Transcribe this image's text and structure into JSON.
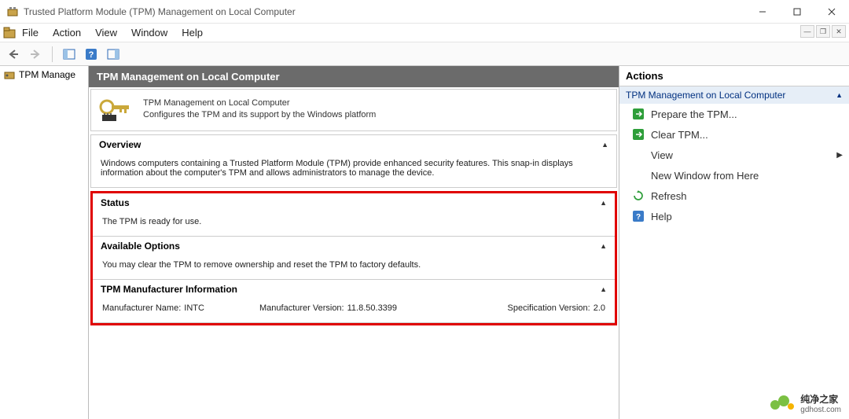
{
  "window": {
    "title": "Trusted Platform Module (TPM) Management on Local Computer"
  },
  "menu": {
    "items": [
      "File",
      "Action",
      "View",
      "Window",
      "Help"
    ]
  },
  "tree": {
    "root": "TPM Manage"
  },
  "center": {
    "header": "TPM Management on Local Computer",
    "desc_title": "TPM Management on Local Computer",
    "desc_body": "Configures the TPM and its support by the Windows platform"
  },
  "sections": {
    "overview": {
      "title": "Overview",
      "body": "Windows computers containing a Trusted Platform Module (TPM) provide enhanced security features. This snap-in displays information about the computer's TPM and allows administrators to manage the device."
    },
    "status": {
      "title": "Status",
      "body": "The TPM is ready for use."
    },
    "options": {
      "title": "Available Options",
      "body": "You may clear the TPM to remove ownership and reset the TPM to factory defaults."
    },
    "mfg": {
      "title": "TPM Manufacturer Information",
      "name_label": "Manufacturer Name:",
      "name_value": "INTC",
      "ver_label": "Manufacturer Version:",
      "ver_value": "11.8.50.3399",
      "spec_label": "Specification Version:",
      "spec_value": "2.0"
    }
  },
  "actions": {
    "header": "Actions",
    "group": "TPM Management on Local Computer",
    "items": {
      "prepare": "Prepare the TPM...",
      "clear": "Clear TPM...",
      "view": "View",
      "new_window": "New Window from Here",
      "refresh": "Refresh",
      "help": "Help"
    }
  },
  "watermark": {
    "line1": "纯净之家",
    "line2": "gdhost.com"
  }
}
